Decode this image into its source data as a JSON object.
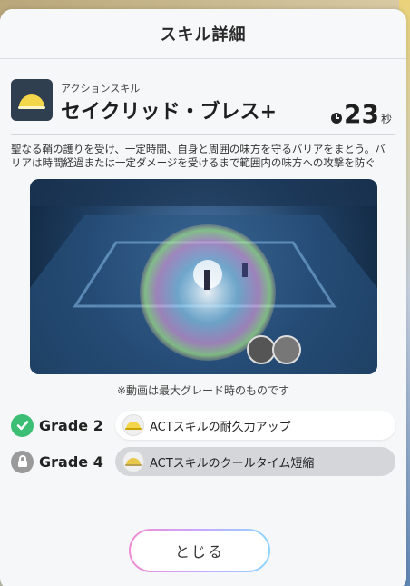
{
  "header": {
    "title": "スキル詳細"
  },
  "skill": {
    "type": "アクションスキル",
    "name": "セイクリッド・ブレス",
    "plus": "+",
    "timer_value": "23",
    "timer_unit": "秒",
    "description": "聖なる鞘の護りを受け、一定時間、自身と周囲の味方を守るバリアをまとう。バリアは時間経過または一定ダメージを受けるまで範囲内の味方への攻撃を防ぐ"
  },
  "video": {
    "note": "※動画は最大グレード時のものです"
  },
  "grades": [
    {
      "label": "Grade 2",
      "text": "ACTスキルの耐久力アップ",
      "state": "unlocked"
    },
    {
      "label": "Grade 4",
      "text": "ACTスキルのクールタイム短縮",
      "state": "locked"
    }
  ],
  "close_button": {
    "label": "とじる"
  },
  "colors": {
    "unlocked_badge": "#3cbf75",
    "locked_badge": "#9a9a9a",
    "skill_icon_bg": "#2f3f50"
  }
}
